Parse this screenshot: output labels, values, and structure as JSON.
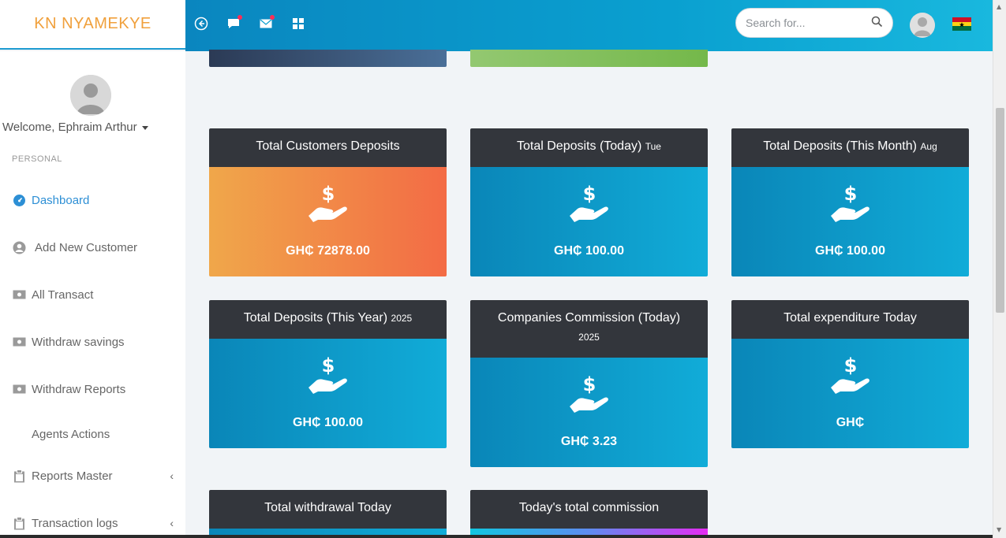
{
  "brand": {
    "name": "KN NYAMEKYE"
  },
  "header": {
    "search_placeholder": "Search for...",
    "icons": [
      "back-circle-icon",
      "chat-icon",
      "mail-icon",
      "grid-icon",
      "search-icon",
      "user-avatar-icon",
      "ghana-flag-icon"
    ]
  },
  "sidebar": {
    "welcome": "Welcome, Ephraim Arthur",
    "section": "PERSONAL",
    "items": [
      {
        "label": "Dashboard",
        "icon": "speedometer-icon"
      },
      {
        "label": "Add New Customer",
        "icon": "user-circle-icon"
      },
      {
        "label": "All Transact",
        "icon": "money-icon"
      },
      {
        "label": "Withdraw savings",
        "icon": "money-icon"
      },
      {
        "label": "Withdraw Reports",
        "icon": "money-icon"
      },
      {
        "label": "Agents Actions",
        "icon": ""
      },
      {
        "label": "Reports Master",
        "icon": "clipboard-icon"
      },
      {
        "label": "Transaction logs",
        "icon": "clipboard-icon"
      }
    ]
  },
  "cards": [
    {
      "title": "Total Customers Deposits",
      "suffix": "",
      "amount": "GH₵ 72878.00"
    },
    {
      "title": "Total Deposits (Today)",
      "suffix": "Tue",
      "amount": "GH₵ 100.00"
    },
    {
      "title": "Total Deposits (This Month)",
      "suffix": "Aug",
      "amount": "GH₵ 100.00"
    },
    {
      "title": "Total Deposits (This Year)",
      "suffix": "2025",
      "amount": "GH₵ 100.00"
    },
    {
      "title": "Companies Commission (Today)",
      "suffix": "2025",
      "amount": "GH₵ 3.23"
    },
    {
      "title": "Total expenditure Today",
      "suffix": "",
      "amount": "GH₵"
    },
    {
      "title": "Total withdrawal Today",
      "suffix": "",
      "amount": ""
    },
    {
      "title": "Today's total commission",
      "suffix": "",
      "amount": ""
    }
  ],
  "colors": {
    "accent": "#0a9fd0",
    "brand": "#f0a03c",
    "card_head": "#33363c",
    "active_nav": "#2d8fd5"
  }
}
